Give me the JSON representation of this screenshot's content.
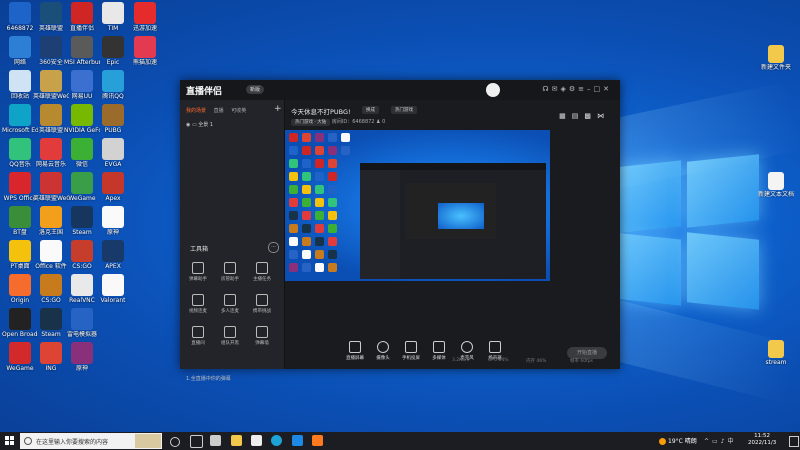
{
  "desktop": {
    "icons_col1": [
      {
        "label": "6468872",
        "color": "#1e63c8"
      },
      {
        "label": "网络",
        "color": "#2d7fd5"
      },
      {
        "label": "回收站",
        "color": "#cfe3f5"
      },
      {
        "label": "Microsoft Edge",
        "color": "#0fa3c7"
      },
      {
        "label": "QQ音乐",
        "color": "#31c27c"
      },
      {
        "label": "WPS Office",
        "color": "#d9262c"
      },
      {
        "label": "BT盘",
        "color": "#3a8e3a"
      },
      {
        "label": "PT桌面",
        "color": "#f4c20d"
      },
      {
        "label": "Origin",
        "color": "#f56c2d"
      },
      {
        "label": "Open Broadcaster",
        "color": "#222"
      },
      {
        "label": "WeGame",
        "color": "#d22a2a"
      }
    ],
    "icons_col2": [
      {
        "label": "英雄联盟",
        "color": "#1a4f7a"
      },
      {
        "label": "360安全",
        "color": "#1d3f74"
      },
      {
        "label": "英雄联盟WeGame版",
        "color": "#c8a24a"
      },
      {
        "label": "英雄联盟",
        "color": "#b88a2f"
      },
      {
        "label": "网易云音乐",
        "color": "#e23b3b"
      },
      {
        "label": "英雄联盟WeGame版",
        "color": "#c33"
      },
      {
        "label": "洛克王国",
        "color": "#f2a01c"
      },
      {
        "label": "Office 软件",
        "color": "#fafafa"
      },
      {
        "label": "CS:GO",
        "color": "#c77b1c"
      },
      {
        "label": "Steam",
        "color": "#18324a"
      },
      {
        "label": "ING",
        "color": "#d43"
      }
    ],
    "icons_col3": [
      {
        "label": "直播伴侣",
        "color": "#cf2525"
      },
      {
        "label": "MSI Afterburner",
        "color": "#5a5a5a"
      },
      {
        "label": "网易UU",
        "color": "#3b6fd0"
      },
      {
        "label": "NVIDIA GeForce",
        "color": "#76b900"
      },
      {
        "label": "微信",
        "color": "#3cb034"
      },
      {
        "label": "WeGame",
        "color": "#3a9e48"
      },
      {
        "label": "Steam",
        "color": "#17365e"
      },
      {
        "label": "CS:GO",
        "color": "#c73d2c"
      },
      {
        "label": "RealVNC",
        "color": "#e9e9e9"
      },
      {
        "label": "雷电模拟器",
        "color": "#2763c4"
      },
      {
        "label": "原神",
        "color": "#8a2f7a"
      }
    ],
    "icons_col4": [
      {
        "label": "TIM",
        "color": "#e8e8e8"
      },
      {
        "label": "Epic",
        "color": "#333"
      },
      {
        "label": "腾讯QQ",
        "color": "#27a0d9"
      },
      {
        "label": "PUBG",
        "color": "#9a6b2a"
      },
      {
        "label": "EVGA",
        "color": "#d2d2d2"
      },
      {
        "label": "Apex",
        "color": "#c5372a"
      },
      {
        "label": "原神",
        "color": "#fafafa"
      },
      {
        "label": "APEX",
        "color": "#173a6a"
      },
      {
        "label": "Valorant",
        "color": "#f9f9f9"
      }
    ],
    "icons_col5": [
      {
        "label": "迅游加速",
        "color": "#e52b2b"
      },
      {
        "label": "熊猫加速",
        "color": "#e33a52"
      }
    ],
    "icons_right": [
      {
        "label": "新建文件夹",
        "color": "#f3c94b"
      },
      {
        "label": "新建文本文档",
        "color": "#f4f4f4"
      },
      {
        "label": "stream",
        "color": "#f3c94b"
      }
    ]
  },
  "app": {
    "brand": "直播伴侣",
    "version": "新版",
    "tabs": [
      "我的场景",
      "直播",
      "可收英"
    ],
    "scene": "全景 1",
    "tools_title": "工具箱",
    "tools": [
      "弹幕助手",
      "房管助手",
      "主播任务",
      "视频连麦",
      "多人连麦",
      "携带挑战",
      "直播间",
      "组队开黑",
      "弹幕墙"
    ],
    "notice": "1.全直播中你的弹幕",
    "live_title": "今天休息不打PUBG!",
    "edit_chip": "换成",
    "category_chip": "热门游戏",
    "meta_a": "热门游戏 · 大陆",
    "meta_b": "房间ID：6468872",
    "meta_c": "0",
    "controls": [
      "直播屏幕",
      "摄像头",
      "手机投屏",
      "多媒体",
      "麦克风",
      "扬声器"
    ],
    "golive": "开始直播",
    "status": [
      "3.2KB/s",
      "CPU 24%",
      "内存 46%",
      "帧率 60fps"
    ]
  },
  "taskbar": {
    "search_placeholder": "在这里输入你要搜索的内容",
    "weather": "19°C 晴朗",
    "time": "11:52",
    "date": "2022/11/3"
  }
}
